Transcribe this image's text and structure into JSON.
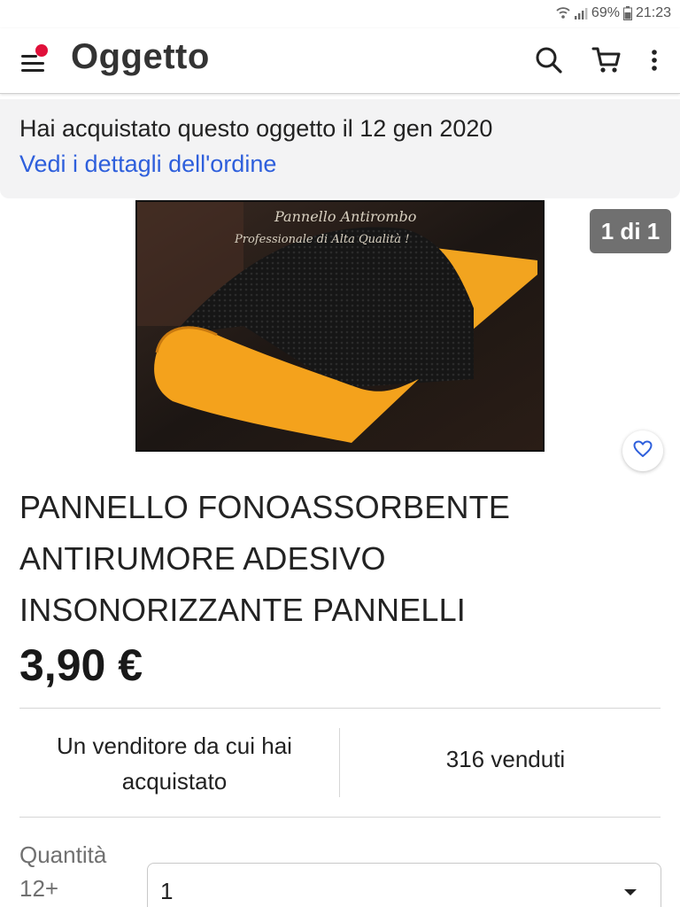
{
  "status_bar": {
    "battery": "69%",
    "time": "21:23",
    "icons": [
      "wifi-icon",
      "signal-icon",
      "battery-icon"
    ]
  },
  "header": {
    "title": "Oggetto",
    "icons": [
      "menu-icon",
      "notification-dot",
      "search-icon",
      "cart-icon",
      "more-vert-icon"
    ]
  },
  "purchase_banner": {
    "text": "Hai acquistato questo oggetto il 12 gen 2020",
    "link": "Vedi i dettagli dell'ordine"
  },
  "image": {
    "overlay_line1": "Pannello Antirombo",
    "overlay_line2": "Professionale di Alta Qualità !",
    "counter": "1 di 1"
  },
  "product": {
    "title": "PANNELLO FONOASSORBENTE ANTIRUMORE ADESIVO INSONORIZZANTE PANNELLI",
    "price": "3,90 €"
  },
  "stats": {
    "seller": "Un venditore da cui hai acquistato",
    "sold": "316 venduti"
  },
  "quantity": {
    "label": "Quantità",
    "available": "12+",
    "selected": "1"
  },
  "colors": {
    "accent_link": "#2e5fdc",
    "notification": "#e0103a",
    "banner_bg": "#f3f3f4",
    "badge_bg": "#707070",
    "panel_orange": "#f4a21c"
  }
}
